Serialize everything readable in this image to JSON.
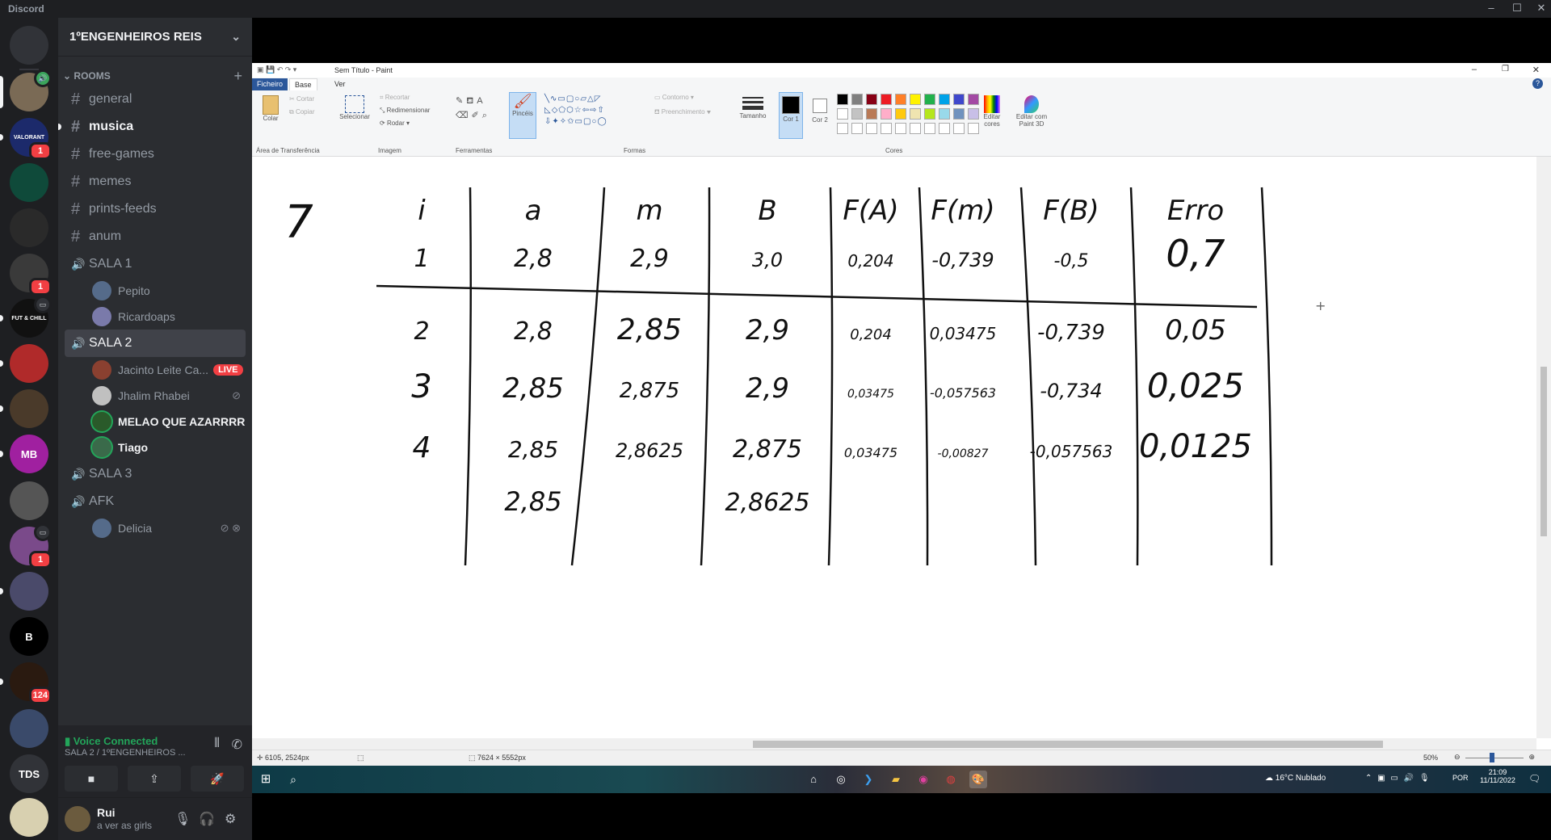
{
  "window": {
    "app_name": "Discord"
  },
  "rail": {
    "servers": [
      {
        "label": "",
        "color": "#5865f2",
        "name": "home"
      },
      {
        "label": "",
        "color": "#7a6a55",
        "badge": "",
        "voice": true
      },
      {
        "label": "VALORANT",
        "color": "#1c2a6b",
        "badge": "1"
      },
      {
        "label": "",
        "color": "#0f4a3a"
      },
      {
        "label": "",
        "color": "#2a2a2a"
      },
      {
        "label": "",
        "color": "#3a3a3a",
        "badge": "1"
      },
      {
        "label": "FUT & CHILL",
        "color": "#111111"
      },
      {
        "label": "",
        "color": "#b02a2a"
      },
      {
        "label": "",
        "color": "#4a3a2a"
      },
      {
        "label": "MB",
        "color": "#a020a0"
      },
      {
        "label": "",
        "color": "#555555"
      },
      {
        "label": "",
        "color": "#7a4a8a",
        "badge": "1"
      },
      {
        "label": "",
        "color": "#4a4a6a"
      },
      {
        "label": "B",
        "color": "#000000"
      },
      {
        "label": "",
        "color": "#2a1a10",
        "badge": "124"
      },
      {
        "label": "",
        "color": "#3a4a6a"
      },
      {
        "label": "TDS",
        "color": "#313338"
      },
      {
        "label": "",
        "color": "#d8d0b0"
      }
    ]
  },
  "sidebar": {
    "guild_name": "1ºENGENHEIROS REIS",
    "category": "ROOMS",
    "text_channels": [
      "general",
      "musica",
      "free-games",
      "memes",
      "prints-feeds",
      "anum"
    ],
    "voice": [
      {
        "name": "SALA 1",
        "users": [
          "Pepito",
          "Ricardoaps"
        ]
      },
      {
        "name": "SALA 2",
        "users": [
          "Jacinto Leite Ca...",
          "Jhalim Rhabei",
          "MELAO QUE AZARRRR",
          "Tiago"
        ],
        "live_label": "LIVE"
      },
      {
        "name": "SALA 3",
        "users": []
      },
      {
        "name": "AFK",
        "users": [
          "Delicia"
        ]
      }
    ],
    "voice_status": "Voice Connected",
    "voice_location": "SALA 2 / 1ºENGENHEIROS ...",
    "user": {
      "name": "Rui",
      "status": "a ver as girls"
    }
  },
  "paint": {
    "title": "Sem Título - Paint",
    "tabs": [
      "Ficheiro",
      "Base",
      "Ver"
    ],
    "clipboard": {
      "paste": "Colar",
      "cut": "Cortar",
      "copy": "Copiar",
      "group": "Área de Transferência"
    },
    "image": {
      "select": "Selecionar",
      "crop": "Recortar",
      "resize": "Redimensionar",
      "rotate": "Rodar",
      "group": "Imagem"
    },
    "tools_group": "Ferramentas",
    "brushes": "Pincéis",
    "shapes": {
      "outline": "Contorno",
      "fill": "Preenchimento",
      "group": "Formas"
    },
    "size": "Tamanho",
    "color1": "Cor 1",
    "color2": "Cor 2",
    "colors_group": "Cores",
    "edit_colors": "Editar cores",
    "paint3d": "Editar com Paint 3D",
    "palette": [
      "#000000",
      "#7f7f7f",
      "#880015",
      "#ed1c24",
      "#ff7f27",
      "#fff200",
      "#22b14c",
      "#00a2e8",
      "#3f48cc",
      "#a349a4",
      "#ffffff",
      "#c3c3c3",
      "#b97a57",
      "#ffaec9",
      "#ffc90e",
      "#efe4b0",
      "#b5e61d",
      "#99d9ea",
      "#7092be",
      "#c8bfe7"
    ],
    "status": {
      "cursor": "6105, 2524px",
      "size": "7624 × 5552px",
      "zoom": "50%"
    }
  },
  "handwriting": {
    "problem": "7",
    "headers": [
      "i",
      "a",
      "m",
      "B",
      "F(A)",
      "F(m)",
      "F(B)",
      "Erro"
    ],
    "rows": [
      [
        "1",
        "2,8",
        "2,9",
        "3,0",
        "0,204",
        "-0,739",
        "-0,5",
        "0,7"
      ],
      [
        "2",
        "2,8",
        "2,85",
        "2,9",
        "0,204",
        "0,03475",
        "-0,739",
        "0,05"
      ],
      [
        "3",
        "2,85",
        "2,875",
        "2,9",
        "0,03475",
        "-0,057563",
        "-0,734",
        "0,025"
      ],
      [
        "4",
        "2,85",
        "2,8625",
        "2,875",
        "0,03475",
        "-0,00827",
        "-0,057563",
        "0,0125"
      ],
      [
        "",
        "2,85",
        "",
        "2,8625",
        "",
        "",
        "",
        ""
      ]
    ]
  },
  "taskbar": {
    "weather": "16°C  Nublado",
    "lang": "POR",
    "time": "21:09",
    "date": "11/11/2022"
  }
}
